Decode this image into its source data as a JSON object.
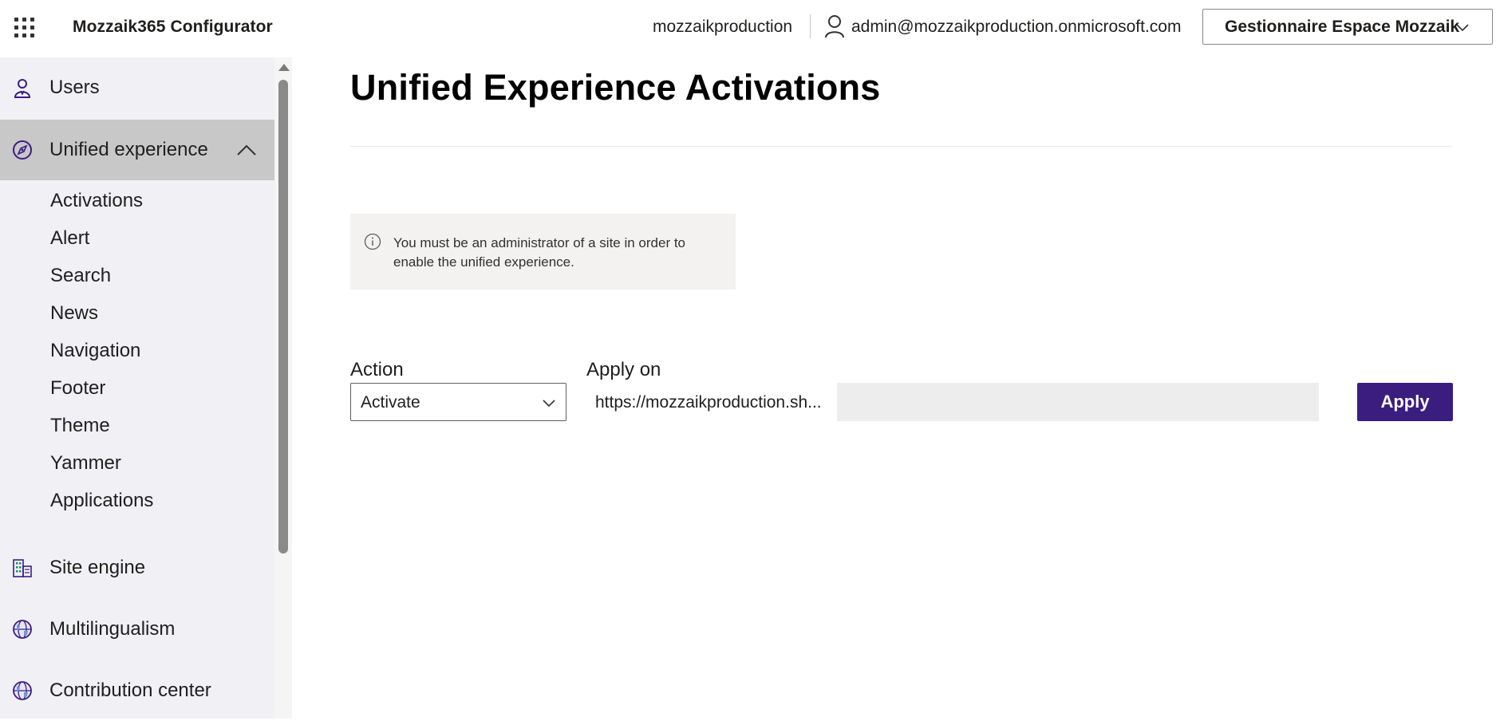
{
  "header": {
    "app_title": "Mozzaik365 Configurator",
    "tenant": "mozzaikproduction",
    "user_email": "admin@mozzaikproduction.onmicrosoft.com",
    "space_selector": "Gestionnaire Espace Mozzaik"
  },
  "sidebar": {
    "items": [
      {
        "label": "Users",
        "icon": "user-icon"
      },
      {
        "label": "Unified experience",
        "icon": "compass-icon",
        "expanded": true,
        "children": [
          "Activations",
          "Alert",
          "Search",
          "News",
          "Navigation",
          "Footer",
          "Theme",
          "Yammer",
          "Applications"
        ]
      },
      {
        "label": "Site engine",
        "icon": "building-icon"
      },
      {
        "label": "Multilingualism",
        "icon": "globe-icon"
      },
      {
        "label": "Contribution center",
        "icon": "globe-icon"
      }
    ]
  },
  "main": {
    "title": "Unified Experience Activations",
    "info_message": "You must be an administrator of a site in order to enable the unified experience.",
    "action_label": "Action",
    "action_value": "Activate",
    "apply_on_label": "Apply on",
    "site_url": "https://mozzaikproduction.sh...",
    "site_input_value": "",
    "apply_button": "Apply"
  },
  "colors": {
    "accent": "#3b1d80",
    "sidebar_bg": "#f0f0f5",
    "active_item_bg": "#c8c8c8",
    "info_bg": "#f3f2f1",
    "icon_purple": "#3b1d80"
  }
}
